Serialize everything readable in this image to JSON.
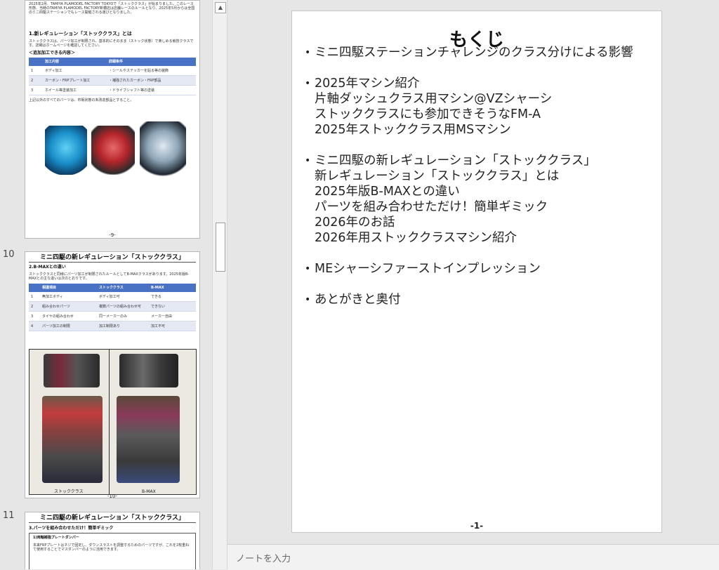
{
  "thumbnails": [
    {
      "number": "",
      "intro": "2025年2月、TAMIYA PLAMODEL FACTORY TOKYOで「ストッククラス」が始まりました。このレース形態、当時のTAMIYA PLAMODEL FACTORY新橋店は店舗レースのルールとなり、2025年5月からは全国のミニ四駆ステーションでもレース開催される運びとなりました。",
      "section": "1.新レギュレーション「ストッククラス」とは",
      "desc": "ストッククラスは、パーツ加工が制限され、基本的にそのまま（ストック状態）で楽しめる競技クラスです。詳細はホームページを確認してください。",
      "table_title": "＜追加加工できる内容＞",
      "table_headers": [
        "",
        "加工内容",
        "詳細条件"
      ],
      "rows": [
        [
          "1",
          "ボディ加工",
          "・シールやステッカーを貼る等の装飾"
        ],
        [
          "2",
          "カーボン・FRPプレート加工",
          "・補強されたカーボン・FRP部品"
        ],
        [
          "3",
          "ホイール等塗装加工",
          "・ドライブシャフト等の塗装"
        ]
      ],
      "note": "上記以外のすべてのパーツは、市販状態の未改造部品とすること。",
      "footer": "-9-"
    },
    {
      "number": "10",
      "title": "ミニ四駆の新レギュレーション「ストッククラス」",
      "section": "2.B-MAXとの違い",
      "desc": "ストッククラスと同様にパーツ加工が制限されたルールとしてB-MAXクラスがあります。2025年版B-MAXとの主な違いは次のとおりです。",
      "table_headers": [
        "",
        "相違項目",
        "ストッククラス",
        "B-MAX"
      ],
      "rows": [
        [
          "1",
          "無加工ボディ",
          "ボディ加工可",
          "できる"
        ],
        [
          "2",
          "組み合わせパーツ",
          "複数パーツの組み合わせ可",
          "できない"
        ],
        [
          "3",
          "タイヤの組み合わせ",
          "同一メーカーのみ",
          "メーカー自由"
        ],
        [
          "4",
          "パーツ加工の制限",
          "加工制限あり",
          "加工不可"
        ]
      ],
      "left_caption": "ストッククラス",
      "right_caption": "B-MAX",
      "footer": "-10-"
    },
    {
      "number": "11",
      "title": "ミニ四駆の新レギュレーション「ストッククラス」",
      "section": "3.パーツを組み合わせただけ！簡単ギミック",
      "sub": "1)両軸補強プレートダンパー",
      "desc": "本来FRPプレートはネジで固定し、ダウンスラストを調整するためのパーツですが、これを2枚重ねて使用することでマスダンパーのように活用できます。"
    }
  ],
  "slide": {
    "title": "もくじ",
    "sections": [
      [
        "ミニ四駆ステーションチャレンジのクラス分けによる影響"
      ],
      [
        "2025年マシン紹介",
        "片軸ダッシュクラス用マシン@VZシャーシ",
        "ストッククラスにも参加できそうなFM-A",
        "2025年ストッククラス用MSマシン"
      ],
      [
        "ミニ四駆の新レギュレーション「ストッククラス」",
        "新レギュレーション「ストッククラス」とは",
        "2025年版B-MAXとの違い",
        "パーツを組み合わせただけ！簡単ギミック",
        "2026年のお話",
        "2026年用ストッククラスマシン紹介"
      ],
      [
        "MEシャーシファーストインプレッション"
      ],
      [
        "あとがきと奥付"
      ]
    ],
    "page_number": "-1-"
  },
  "notes": {
    "placeholder": "ノートを入力"
  },
  "icons": {
    "scroll_up": "triangle-up-icon"
  },
  "colors": {
    "table_header": "#4a72c4",
    "table_band": "#e4e9f4",
    "workspace": "#e6e6e6"
  }
}
